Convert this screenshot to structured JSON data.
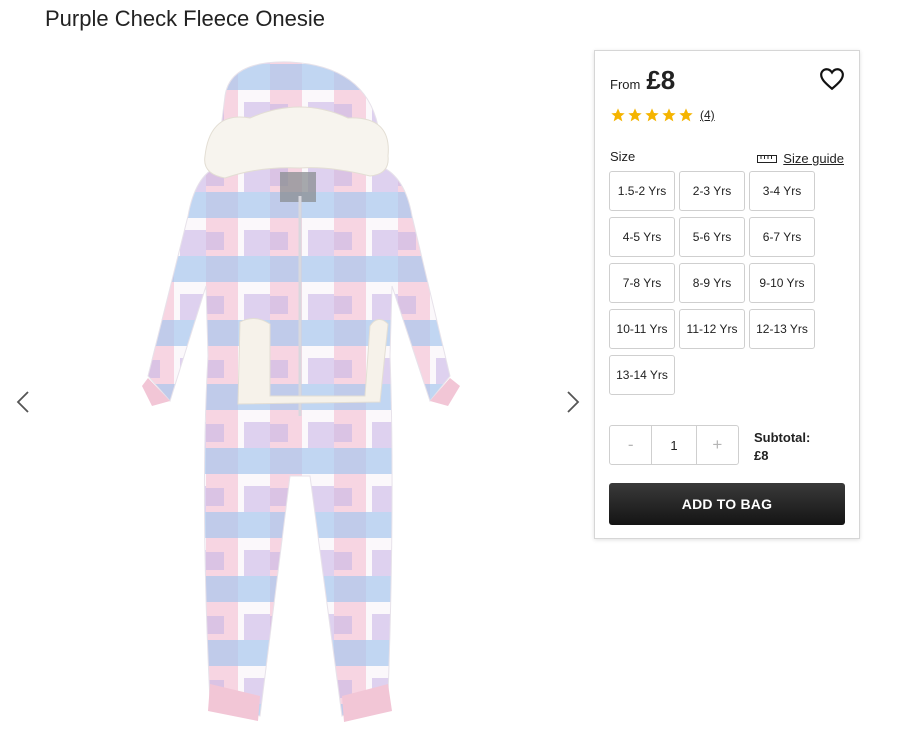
{
  "product": {
    "title": "Purple Check Fleece Onesie"
  },
  "gallery": {
    "prev_icon": "chevron-left-icon",
    "next_icon": "chevron-right-icon"
  },
  "purchase": {
    "from_label": "From",
    "price": "£8",
    "wishlist_icon": "heart-icon",
    "rating": 5,
    "review_count": "(4)",
    "size_label": "Size",
    "size_guide_label": "Size guide",
    "size_guide_icon": "ruler-icon",
    "sizes": [
      "1.5-2 Yrs",
      "2-3 Yrs",
      "3-4 Yrs",
      "4-5 Yrs",
      "5-6 Yrs",
      "6-7 Yrs",
      "7-8 Yrs",
      "8-9 Yrs",
      "9-10 Yrs",
      "10-11 Yrs",
      "11-12 Yrs",
      "12-13 Yrs",
      "13-14 Yrs"
    ],
    "quantity": {
      "minus": "-",
      "value": "1",
      "plus": "+"
    },
    "subtotal_label": "Subtotal:",
    "subtotal_value": "£8",
    "add_button": "ADD TO BAG"
  },
  "colors": {
    "star": "#f5b400",
    "button": "#222222"
  }
}
